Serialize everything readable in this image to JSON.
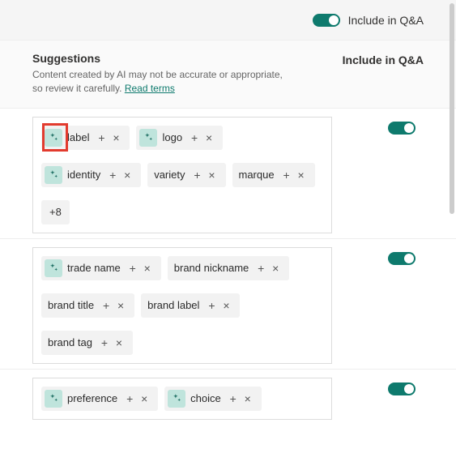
{
  "topbar": {
    "toggle_label": "Include in Q&A",
    "toggle_on": true
  },
  "header": {
    "title": "Suggestions",
    "subtitle_prefix": "Content created by AI may not be accurate or appropriate, so review it carefully. ",
    "terms_link": "Read terms",
    "column_label": "Include in Q&A"
  },
  "groups": [
    {
      "toggle_on": true,
      "highlight_first_icon": true,
      "chips": [
        {
          "ai": true,
          "label": "label"
        },
        {
          "ai": true,
          "label": "logo"
        },
        {
          "ai": true,
          "label": "identity"
        },
        {
          "ai": false,
          "label": "variety"
        },
        {
          "ai": false,
          "label": "marque"
        }
      ],
      "overflow": "+8"
    },
    {
      "toggle_on": true,
      "highlight_first_icon": false,
      "chips": [
        {
          "ai": true,
          "label": "trade name"
        },
        {
          "ai": false,
          "label": "brand nickname"
        },
        {
          "ai": false,
          "label": "brand title"
        },
        {
          "ai": false,
          "label": "brand label"
        },
        {
          "ai": false,
          "label": "brand tag"
        }
      ],
      "overflow": null
    },
    {
      "toggle_on": true,
      "highlight_first_icon": false,
      "chips": [
        {
          "ai": true,
          "label": "preference"
        },
        {
          "ai": true,
          "label": "choice"
        }
      ],
      "overflow": null
    }
  ],
  "icons": {
    "sparkle_name": "sparkle-icon"
  }
}
